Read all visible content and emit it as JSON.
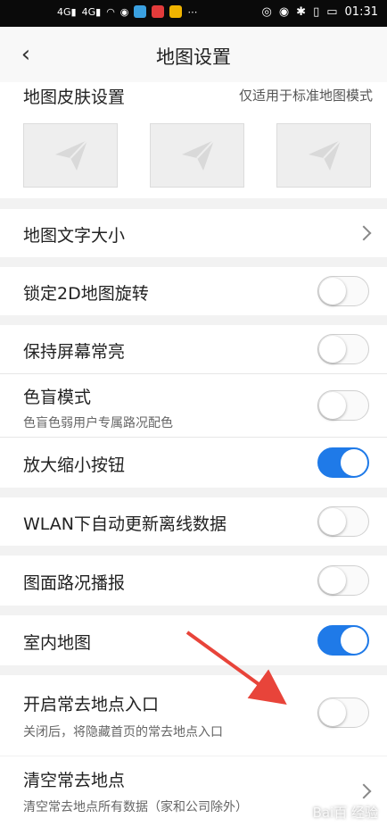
{
  "status_bar": {
    "left_indicators": [
      "4G",
      "4G"
    ],
    "time": "01:31"
  },
  "header": {
    "title": "地图设置"
  },
  "skin": {
    "title": "地图皮肤设置",
    "note": "仅适用于标准地图模式"
  },
  "items": {
    "text_size": {
      "label": "地图文字大小"
    },
    "lock_2d": {
      "label": "锁定2D地图旋转",
      "on": false
    },
    "keep_screen": {
      "label": "保持屏幕常亮",
      "on": false
    },
    "color_blind": {
      "label": "色盲模式",
      "sub": "色盲色弱用户专属路况配色",
      "on": false
    },
    "zoom_buttons": {
      "label": "放大缩小按钮",
      "on": true
    },
    "wlan_update": {
      "label": "WLAN下自动更新离线数据",
      "on": false
    },
    "traffic_broadcast": {
      "label": "图面路况播报",
      "on": false
    },
    "indoor_map": {
      "label": "室内地图",
      "on": true
    },
    "frequent_places": {
      "label": "开启常去地点入口",
      "sub": "关闭后，将隐藏首页的常去地点入口",
      "on": false
    },
    "clear_places": {
      "label": "清空常去地点",
      "sub": "清空常去地点所有数据（家和公司除外）"
    }
  },
  "colors": {
    "accent": "#1f7ae8",
    "annotation_arrow": "#e8443a"
  }
}
